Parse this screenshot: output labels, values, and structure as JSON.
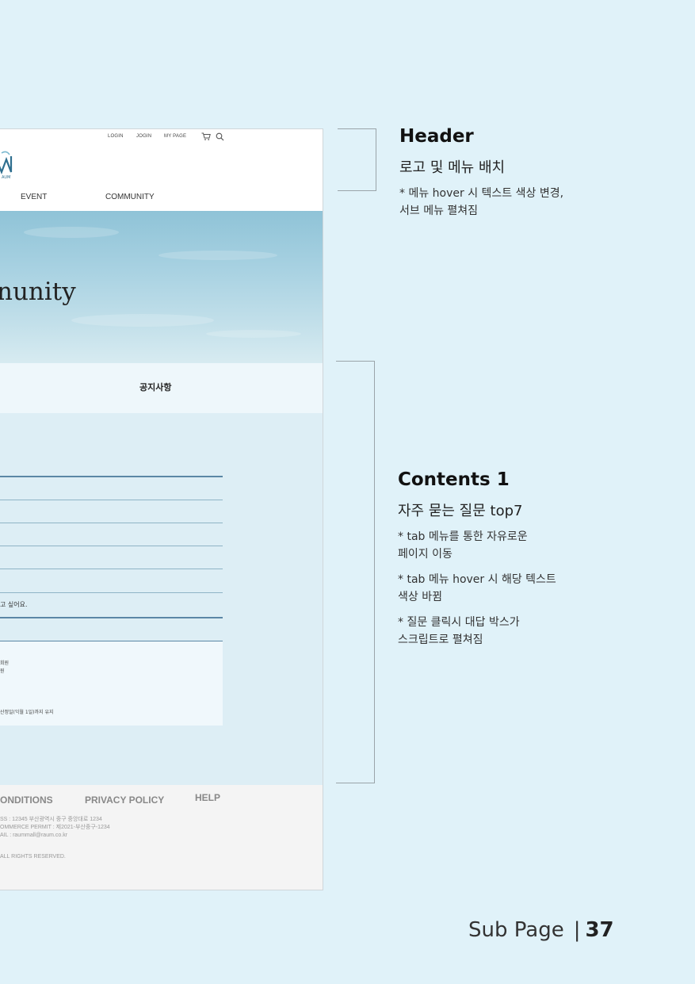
{
  "mockup": {
    "util_nav": [
      "LOGIN",
      "JOGIN",
      "MY PAGE"
    ],
    "logo_text": "AUM",
    "nav": [
      "EVENT",
      "COMMUNITY"
    ],
    "hero_title": "nunity",
    "tab_label": "공지사항",
    "faq_partial_question": "고 싶어요.",
    "answer_lines": [
      "회원",
      "원",
      "산정일(익월 1일)까지 유지"
    ],
    "footer": {
      "links": [
        "ONDITIONS",
        "PRIVACY POLICY",
        "HELP"
      ],
      "info": [
        "SS : 12345 부산광역시 중구 중앙대로 1234",
        "OMMERCE PERMIT : 제2021-부산중구-1234",
        "AIL : raummall@raum.co.kr"
      ],
      "copyright": "ALL RIGHTS RESERVED."
    }
  },
  "annotations": {
    "header": {
      "title": "Header",
      "subtitle": "로고 및 메뉴 배치",
      "notes": [
        "* 메뉴 hover 시 텍스트 색상 변경,",
        "서브 메뉴 펼쳐짐"
      ]
    },
    "contents1": {
      "title": "Contents 1",
      "subtitle": "자주 묻는 질문 top7",
      "notes": [
        "* tab 메뉴를 통한 자유로운",
        "페이지 이동",
        "* tab 메뉴 hover 시 해당 텍스트",
        "색상  바뀜",
        "* 질문 클릭시 대답 박스가",
        "스크립트로 펼쳐짐"
      ]
    }
  },
  "page_footer": {
    "label": "Sub Page",
    "separator": "|",
    "number": "37"
  }
}
